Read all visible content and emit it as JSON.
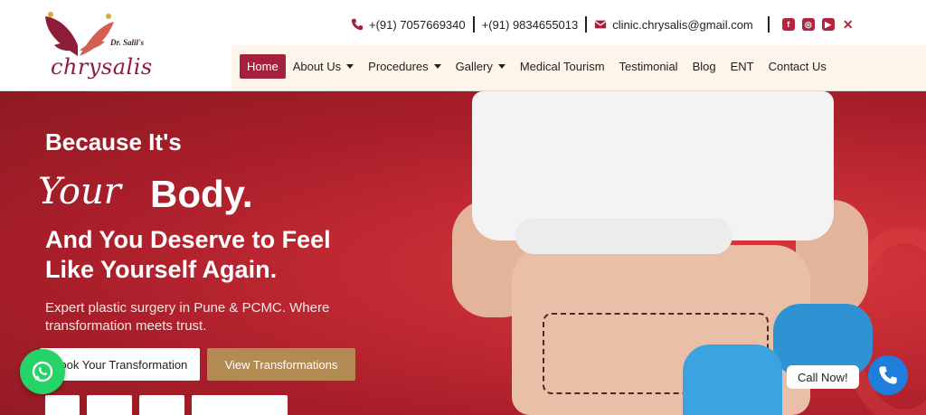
{
  "logo": {
    "prefix": "Dr. Salil's",
    "name": "chrysalis"
  },
  "contact": {
    "phone1": "+(91) 7057669340",
    "phone2": "+(91) 9834655013",
    "email": "clinic.chrysalis@gmail.com"
  },
  "social": [
    "facebook-icon",
    "instagram-icon",
    "youtube-icon",
    "x-icon"
  ],
  "nav": {
    "items": [
      {
        "label": "Home",
        "active": true
      },
      {
        "label": "About Us",
        "dropdown": true
      },
      {
        "label": "Procedures",
        "dropdown": true
      },
      {
        "label": "Gallery",
        "dropdown": true
      },
      {
        "label": "Medical Tourism"
      },
      {
        "label": "Testimonial"
      },
      {
        "label": "Blog"
      },
      {
        "label": "ENT"
      },
      {
        "label": "Contact Us"
      }
    ]
  },
  "hero": {
    "line1": "Because It's",
    "your": "Your",
    "body": "Body.",
    "line3a": "And You Deserve to Feel",
    "line3b": "Like Yourself Again.",
    "sub1": "Expert plastic surgery in Pune & PCMC. Where",
    "sub2": "transformation meets trust.",
    "btn_book": "Book Your Transformation",
    "btn_view": "View Transformations"
  },
  "floating": {
    "call_now": "Call Now!"
  },
  "colors": {
    "brand": "#a4213d",
    "hero_red": "#c22a33",
    "gold": "#b48a54",
    "nav_bg": "#fdf5ea"
  }
}
